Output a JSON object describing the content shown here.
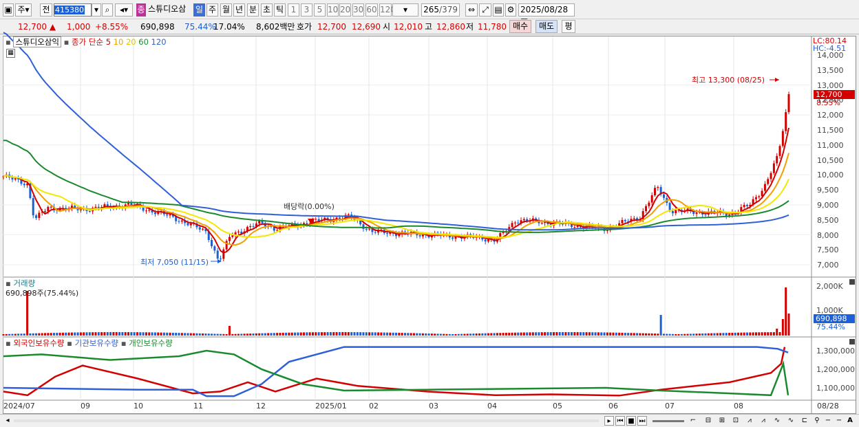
{
  "toolbar": {
    "period_label": "주",
    "all_label": "전",
    "code_value": "415380",
    "stock_badge": "종",
    "stock_name": "스튜디오삼",
    "interval_buttons": [
      "일",
      "주",
      "월",
      "년",
      "분",
      "초",
      "틱"
    ],
    "num_buttons": [
      "1",
      "3",
      "5",
      "10",
      "20",
      "30",
      "60",
      "120"
    ],
    "count_value": "265",
    "count_total": "/379",
    "date_value": "2025/08/28"
  },
  "quote": {
    "price": "12,700",
    "change_sign": "▲",
    "change": "1,000",
    "change_pct": "+8.55%",
    "volume": "690,898",
    "volume_pct": "75.44%",
    "turnover_pct": "17.04%",
    "amount": "8,602백만",
    "ask_label": "호가",
    "ask1": "12,700",
    "ask2": "12,690",
    "open_label": "시",
    "open": "12,010",
    "high_label": "고",
    "high": "12,860",
    "low_label": "저",
    "low": "11,780",
    "buy_label": "매수",
    "sell_label": "매도",
    "avg_label": "평"
  },
  "price_panel": {
    "stock_title": "스튜디오삼익",
    "ma_label": "종가 단순",
    "ma_periods": [
      "5",
      "10",
      "20",
      "60",
      "120"
    ],
    "ma_colors": [
      "#d40000",
      "#f0a000",
      "#f2e800",
      "#1a8a2e",
      "#2f5fd8"
    ],
    "lc_label": "LC:80.14",
    "hc_label": "HC:-4.51",
    "annot_high": "최고 13,300 (08/25)",
    "annot_low": "최저 7,050 (11/15)",
    "annot_div": "배당락(0.00%)",
    "current_tag": "12,700",
    "current_pct": "8.55%",
    "y_ticks": [
      "14,000",
      "13,500",
      "13,000",
      "12,500",
      "12,000",
      "11,500",
      "11,000",
      "10,500",
      "10,000",
      "9,500",
      "9,000",
      "8,500",
      "8,000",
      "7,500",
      "7,000"
    ]
  },
  "volume_panel": {
    "title": "거래량",
    "subtitle": "690,898주(75.44%)",
    "y_ticks": [
      "2,000K",
      "1,000K"
    ],
    "current_tag": "690,898",
    "current_pct": "75.44%"
  },
  "holdings_panel": {
    "series_labels": [
      "외국인보유수량",
      "기관보유수량",
      "개인보유수량"
    ],
    "series_colors": [
      "#d40000",
      "#2f5fd8",
      "#1a8a2e"
    ],
    "y_ticks": [
      "1,300,000",
      "1,200,000",
      "1,100,000"
    ]
  },
  "x_axis": {
    "labels": [
      "2024/07",
      "09",
      "10",
      "11",
      "12",
      "2025/01",
      "02",
      "03",
      "04",
      "05",
      "06",
      "07",
      "08",
      "08/28"
    ]
  },
  "colors": {
    "up": "#d40000",
    "down": "#1c5fd6",
    "selected": "#3a6fd8"
  }
}
